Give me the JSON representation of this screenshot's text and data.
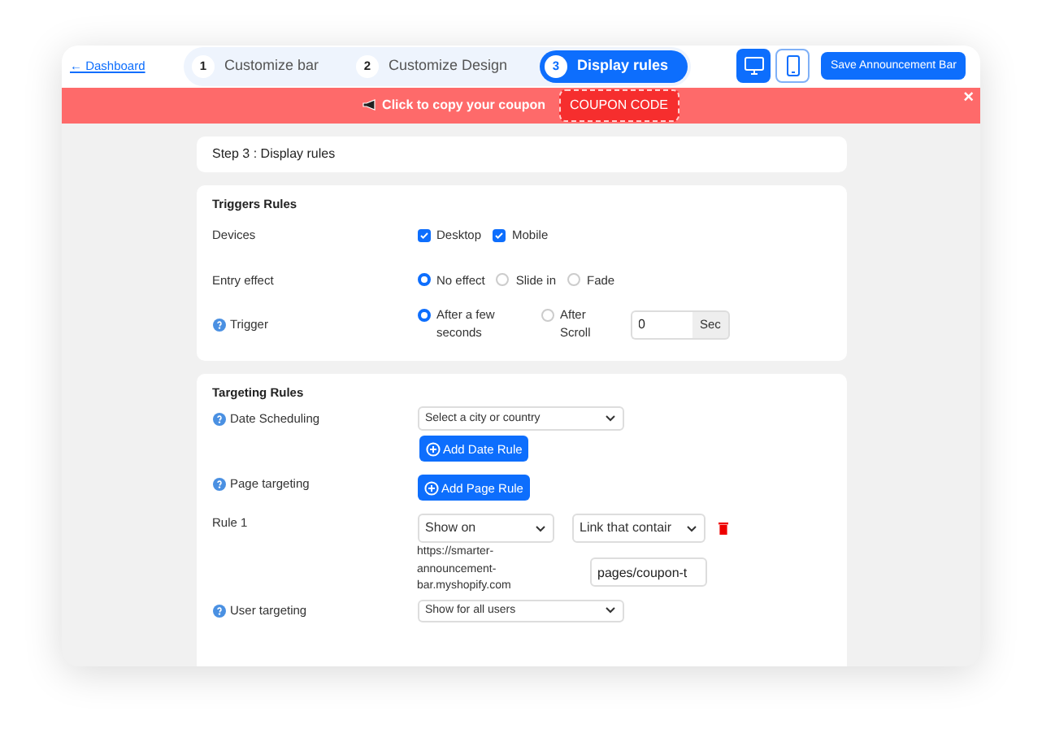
{
  "header": {
    "back_link": "← Dashboard",
    "steps": [
      {
        "number": "1",
        "label": "Customize bar",
        "selected": false
      },
      {
        "number": "2",
        "label": "Customize Design",
        "selected": false
      },
      {
        "number": "3",
        "label": "Display rules",
        "selected": true
      }
    ],
    "devices": [
      {
        "kind": "desktop",
        "selected": true
      },
      {
        "kind": "mobile",
        "selected": false
      }
    ],
    "save_button": "Save Announcement Bar"
  },
  "announcement": {
    "text": "Click to copy your coupon",
    "coupon": "COUPON CODE",
    "close": "×"
  },
  "step_title": "Step 3 : Display rules",
  "triggers": {
    "title": "Triggers Rules",
    "devices": {
      "label": "Devices",
      "options": [
        {
          "label": "Desktop",
          "checked": true
        },
        {
          "label": "Mobile",
          "checked": true
        }
      ]
    },
    "entry_effect": {
      "label": "Entry effect",
      "options": [
        {
          "label": "No effect",
          "selected": true
        },
        {
          "label": "Slide in",
          "selected": false
        },
        {
          "label": "Fade",
          "selected": false
        }
      ]
    },
    "trigger": {
      "label": "Trigger",
      "options": [
        {
          "label": "After a few seconds",
          "selected": true
        },
        {
          "label": "After Scroll",
          "selected": false
        }
      ],
      "value": "0",
      "unit": "Sec"
    }
  },
  "targeting": {
    "title": "Targeting Rules",
    "date_scheduling": {
      "label": "Date Scheduling",
      "select": "Select a city or country",
      "button": "Add Date Rule"
    },
    "page_targeting": {
      "label": "Page targeting",
      "button": "Add Page Rule"
    },
    "rule": {
      "label": "Rule 1",
      "mode": "Show on",
      "match": "Link that contair",
      "base_url": "https://smarter-announcement-bar.myshopify.com",
      "path": "pages/coupon-t"
    },
    "user_targeting": {
      "label": "User targeting",
      "select": "Show for all users"
    }
  }
}
